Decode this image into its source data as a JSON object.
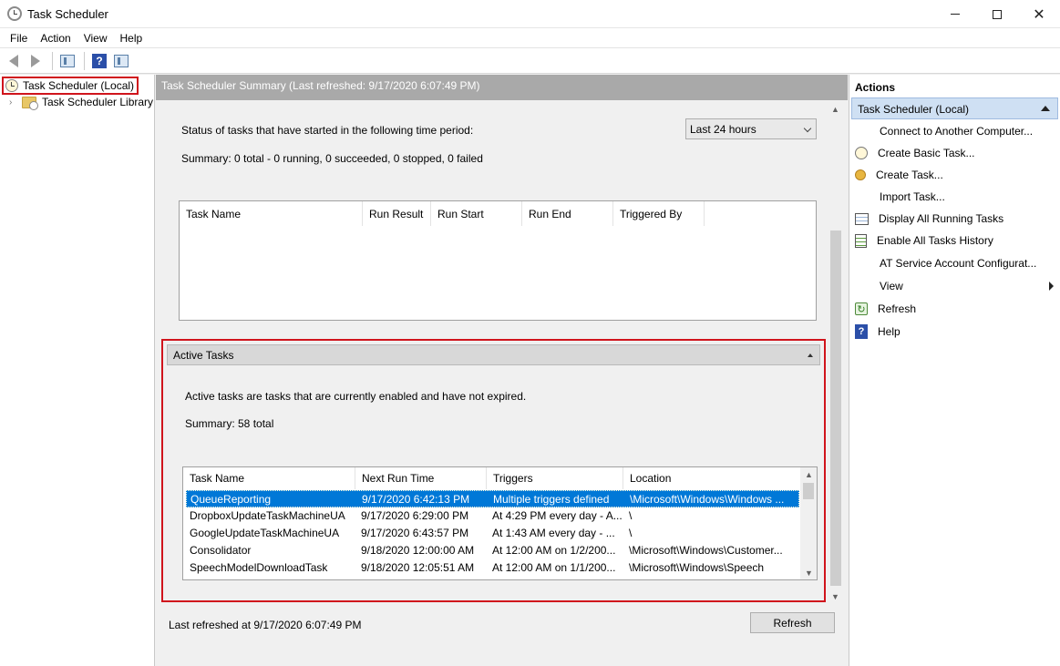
{
  "window": {
    "title": "Task Scheduler",
    "minimize_glyph": "",
    "close_glyph": "✕"
  },
  "menu": {
    "file": "File",
    "action": "Action",
    "view": "View",
    "help": "Help"
  },
  "tree": {
    "root": "Task Scheduler (Local)",
    "library": "Task Scheduler Library"
  },
  "summary": {
    "header": "Task Scheduler Summary (Last refreshed: 9/17/2020 6:07:49 PM)",
    "status_label": "Status of tasks that have started in the following time period:",
    "period": "Last 24 hours",
    "summary_text": "Summary: 0 total - 0 running, 0 succeeded, 0 stopped, 0 failed",
    "columns": [
      "Task Name",
      "Run Result",
      "Run Start",
      "Run End",
      "Triggered By"
    ]
  },
  "active": {
    "title": "Active Tasks",
    "description": "Active tasks are tasks that are currently enabled and have not expired.",
    "summary": "Summary: 58 total",
    "columns": [
      "Task Name",
      "Next Run Time",
      "Triggers",
      "Location"
    ],
    "rows": [
      [
        "QueueReporting",
        "9/17/2020 6:42:13 PM",
        "Multiple triggers defined",
        "\\Microsoft\\Windows\\Windows ..."
      ],
      [
        "DropboxUpdateTaskMachineUA",
        "9/17/2020 6:29:00 PM",
        "At 4:29 PM every day - A...",
        "\\"
      ],
      [
        "GoogleUpdateTaskMachineUA",
        "9/17/2020 6:43:57 PM",
        "At 1:43 AM every day - ...",
        "\\"
      ],
      [
        "Consolidator",
        "9/18/2020 12:00:00 AM",
        "At 12:00 AM on 1/2/200...",
        "\\Microsoft\\Windows\\Customer..."
      ],
      [
        "SpeechModelDownloadTask",
        "9/18/2020 12:05:51 AM",
        "At 12:00 AM on 1/1/200...",
        "\\Microsoft\\Windows\\Speech"
      ]
    ]
  },
  "footer": {
    "last_refreshed": "Last refreshed at 9/17/2020 6:07:49 PM",
    "refresh_button": "Refresh"
  },
  "actions": {
    "title": "Actions",
    "group": "Task Scheduler (Local)",
    "items": [
      "Connect to Another Computer...",
      "Create Basic Task...",
      "Create Task...",
      "Import Task...",
      "Display All Running Tasks",
      "Enable All Tasks History",
      "AT Service Account Configurat...",
      "View",
      "Refresh",
      "Help"
    ]
  },
  "icons": {
    "help_glyph": "?",
    "refresh_glyph": "↻"
  },
  "colors": {
    "selection": "#0078d7",
    "highlight_border": "#d0141c",
    "header_gray": "#a9a9a9"
  }
}
